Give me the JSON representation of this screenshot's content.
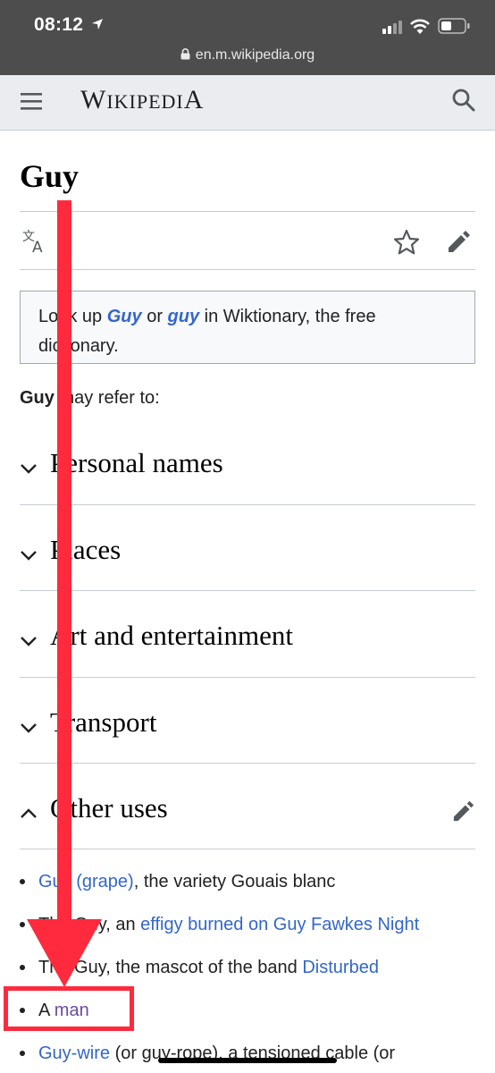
{
  "status_bar": {
    "time": "08:12",
    "url": "en.m.wikipedia.org"
  },
  "header": {
    "wordmark_first": "W",
    "wordmark_small": "IKIPEDI",
    "wordmark_last": "A"
  },
  "page": {
    "title": "Guy"
  },
  "wiktionary": {
    "text_1": "Look up ",
    "link_1": "Guy",
    "text_2": " or ",
    "link_2": "guy",
    "text_3": " in Wiktionary, the free dictionary."
  },
  "intro": {
    "bold": "Guy",
    "rest": " may refer to:"
  },
  "sections": [
    {
      "title": "Personal names",
      "expanded": false
    },
    {
      "title": "Places",
      "expanded": false
    },
    {
      "title": "Art and entertainment",
      "expanded": false
    },
    {
      "title": "Transport",
      "expanded": false
    },
    {
      "title": "Other uses",
      "expanded": true
    }
  ],
  "other_uses": [
    {
      "link": "Guy (grape)",
      "text": ", the variety Gouais blanc"
    },
    {
      "text": "The Guy, an ",
      "link": "effigy burned on Guy Fawkes Night"
    },
    {
      "text": "The Guy, the mascot of the band ",
      "link": "Disturbed"
    },
    {
      "text": "A ",
      "link": "man"
    },
    {
      "link": "Guy-wire",
      "text": " (or guy-rope), a tensioned cable (or"
    }
  ],
  "colors": {
    "link": "#3366cc",
    "visited_link": "#6b4ba1",
    "annotation": "#ff2a3d"
  }
}
